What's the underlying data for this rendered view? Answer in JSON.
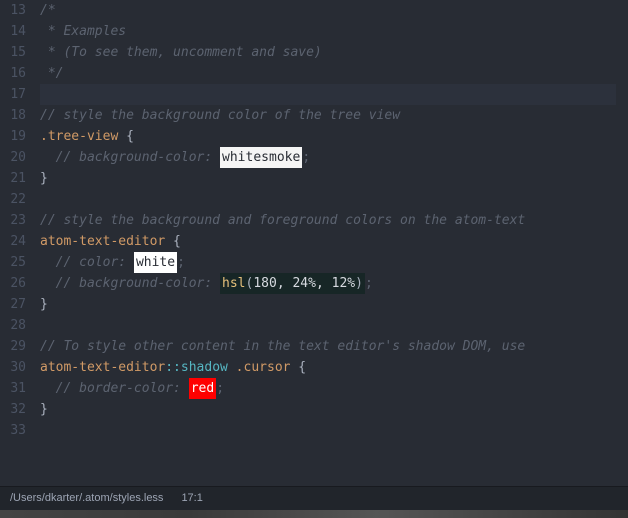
{
  "gutter": {
    "start": 13,
    "end": 33
  },
  "lines": {
    "l13": {
      "comment": "/*"
    },
    "l14": {
      "comment": " * Examples"
    },
    "l15": {
      "comment": " * (To see them, uncomment and save)"
    },
    "l16": {
      "comment": " */"
    },
    "l17": {
      "empty": ""
    },
    "l18": {
      "comment": "// style the background color of the tree view"
    },
    "l19": {
      "selector": ".tree-view",
      "brace": " {"
    },
    "l20": {
      "comment_before": "// background-color: ",
      "swatch": "whitesmoke",
      "semi": ";"
    },
    "l21": {
      "brace": "}"
    },
    "l22": {
      "empty": ""
    },
    "l23": {
      "comment": "// style the background and foreground colors on the atom-text"
    },
    "l24": {
      "selector": "atom-text-editor",
      "brace": " {"
    },
    "l25": {
      "comment_before": "// color: ",
      "swatch": "white",
      "semi": ";"
    },
    "l26": {
      "comment_before": "// background-color: ",
      "func": "hsl",
      "p1": "(",
      "n1": "180",
      "c1": ", ",
      "n2": "24%",
      "c2": ", ",
      "n3": "12%",
      "p2": ")",
      "semi": ";"
    },
    "l27": {
      "brace": "}"
    },
    "l28": {
      "empty": ""
    },
    "l29": {
      "comment": "// To style other content in the text editor's shadow DOM, use"
    },
    "l30": {
      "selector": "atom-text-editor",
      "pseudo": "::shadow",
      "selector2": " .cursor",
      "brace": " {"
    },
    "l31": {
      "comment_before": "// border-color: ",
      "swatch": "red",
      "semi": ";"
    },
    "l32": {
      "brace": "}"
    },
    "l33": {
      "empty": ""
    }
  },
  "status": {
    "filepath": "/Users/dkarter/.atom/styles.less",
    "position": "17:1"
  }
}
